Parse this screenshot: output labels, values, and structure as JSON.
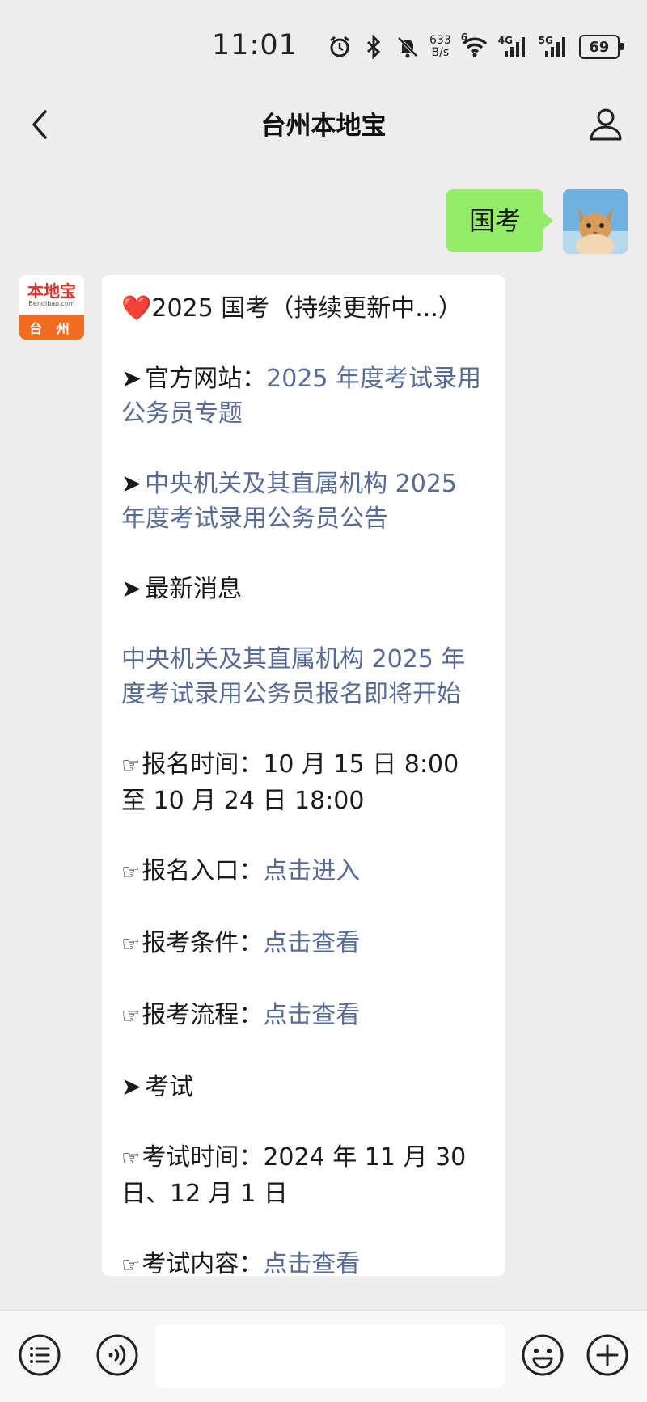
{
  "status_bar": {
    "time": "11:01",
    "net_speed_value": "633",
    "net_speed_unit": "B/s",
    "wifi_badge": "6",
    "signal1_label": "4G",
    "signal2_label": "5G",
    "battery": "69"
  },
  "header": {
    "title": "台州本地宝"
  },
  "chat": {
    "user_message": "国考",
    "bot_avatar": {
      "logo_text": "本地宝",
      "logo_url": "Bendibao.com",
      "city": "台 州"
    },
    "bot_message": {
      "heading_emoji": "❤️",
      "heading": "2025 国考（持续更新中...）",
      "arrow": "➤",
      "hand": "☞",
      "official_site_label": "官方网站：",
      "official_site_link": "2025 年度考试录用公务员专题",
      "announcement_link": "中央机关及其直属机构 2025 年度考试录用公务员公告",
      "latest_news_label": "最新消息",
      "latest_news_link": "中央机关及其直属机构 2025 年度考试录用公务员报名即将开始",
      "signup_time_label": "报名时间：",
      "signup_time_value": "10 月 15 日 8:00 至 10 月 24 日 18:00",
      "signup_entry_label": "报名入口：",
      "signup_entry_link": "点击进入",
      "conditions_label": "报考条件：",
      "conditions_link": "点击查看",
      "process_label": "报考流程：",
      "process_link": "点击查看",
      "exam_label": "考试",
      "exam_time_label": "考试时间：",
      "exam_time_value": "2024 年 11 月 30 日、12 月 1 日",
      "exam_content_label": "考试内容：",
      "exam_content_link": "点击查看"
    }
  },
  "input_bar": {
    "menu_icon": "menu-list-icon",
    "voice_icon": "voice-icon",
    "emoji_icon": "emoji-icon",
    "plus_icon": "plus-icon"
  },
  "colors": {
    "background": "#ededed",
    "user_bubble": "#95ec69",
    "link": "#576b95",
    "brand_orange": "#f26b21"
  }
}
